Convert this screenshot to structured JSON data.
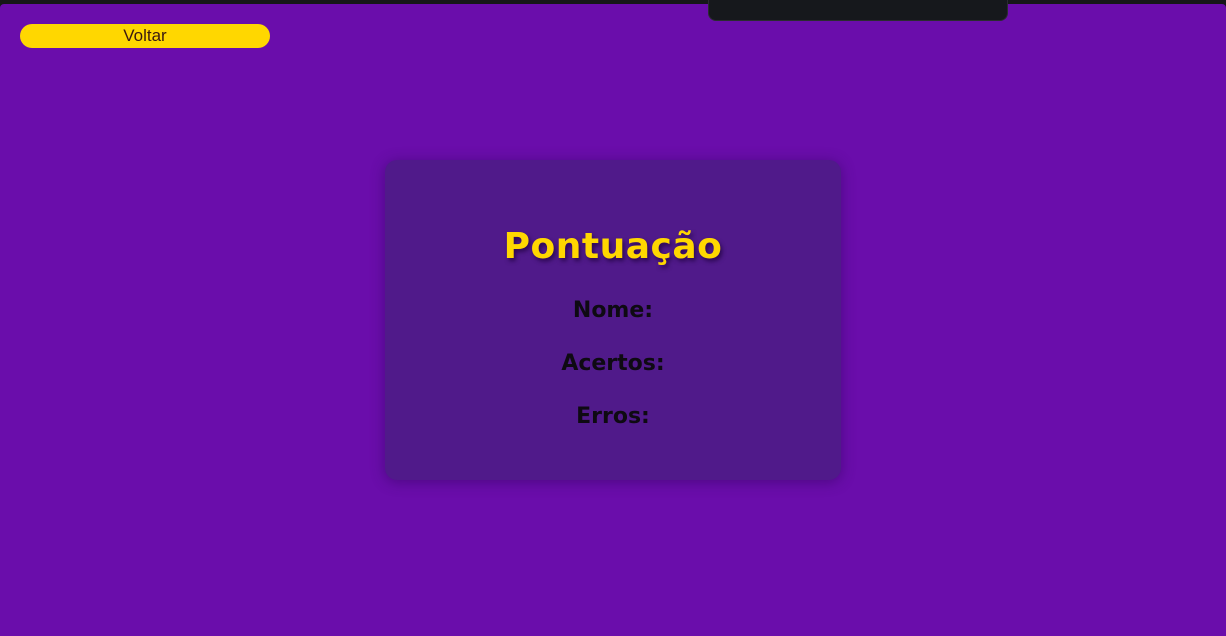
{
  "colors": {
    "background": "#6a0dab",
    "card": "#501a8a",
    "accent": "#ffd700",
    "text": "#0e0a12"
  },
  "nav": {
    "back_label": "Voltar"
  },
  "score": {
    "title": "Pontuação",
    "name_label": "Nome:",
    "hits_label": "Acertos:",
    "errors_label": "Erros:"
  }
}
